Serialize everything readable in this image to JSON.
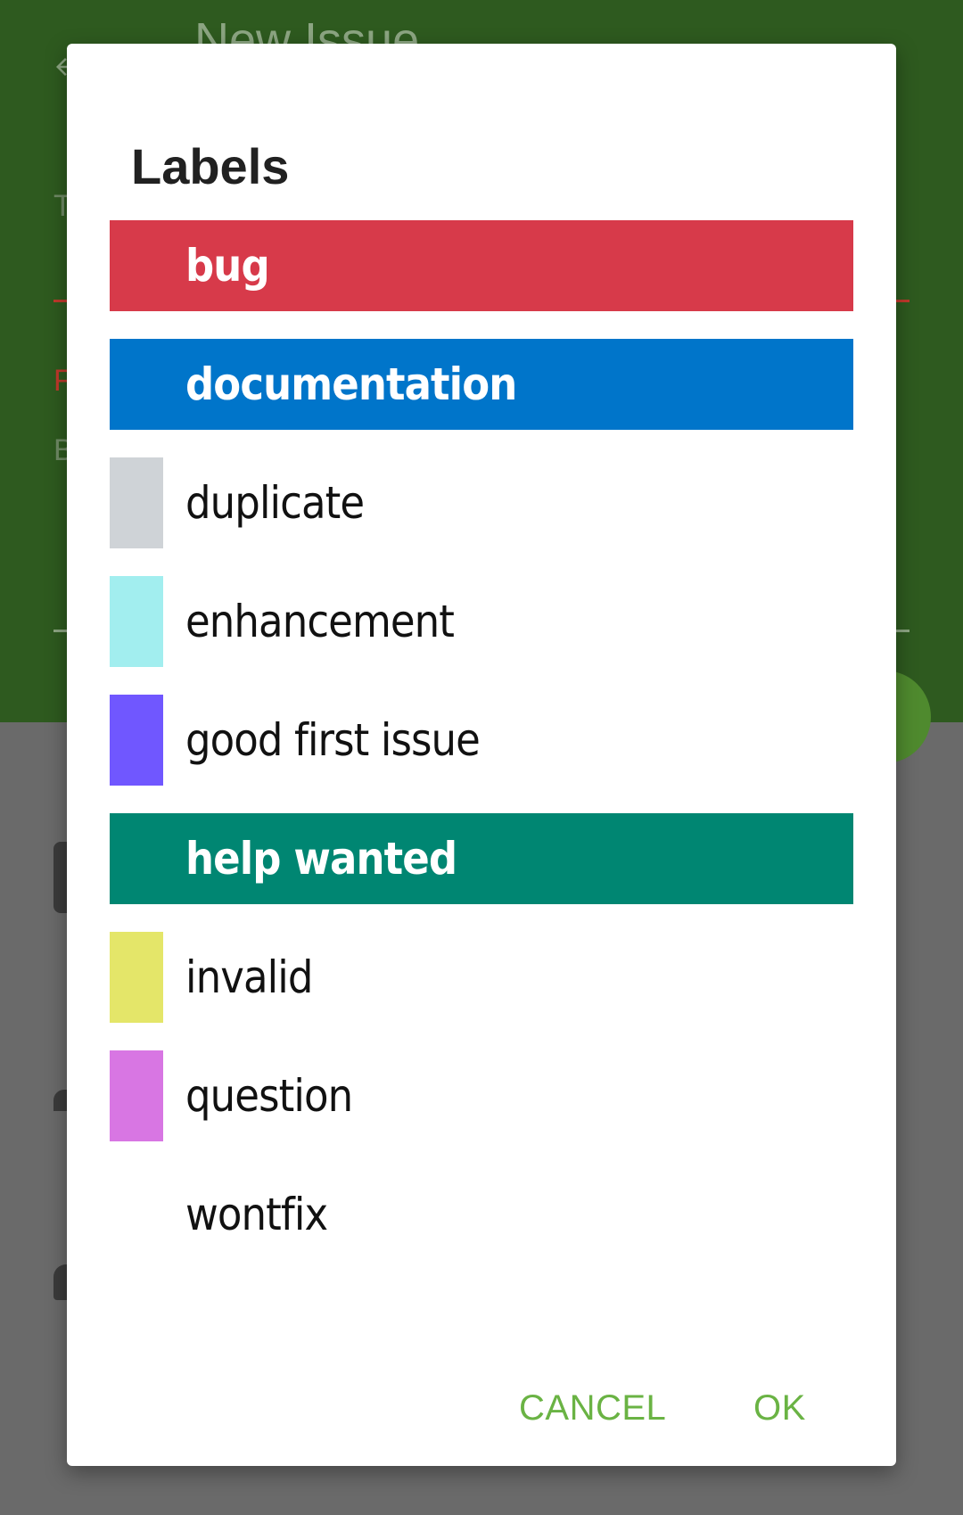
{
  "background": {
    "app_title": "New Issue",
    "field_letters": [
      "T",
      "F",
      "B"
    ]
  },
  "dialog": {
    "title": "Labels",
    "labels": [
      {
        "name": "bug",
        "color": "#d73a4a",
        "selected": true
      },
      {
        "name": "documentation",
        "color": "#0075ca",
        "selected": true
      },
      {
        "name": "duplicate",
        "color": "#cfd3d7",
        "selected": false
      },
      {
        "name": "enhancement",
        "color": "#a2eeef",
        "selected": false
      },
      {
        "name": "good first issue",
        "color": "#7057ff",
        "selected": false
      },
      {
        "name": "help wanted",
        "color": "#008672",
        "selected": true
      },
      {
        "name": "invalid",
        "color": "#e4e669",
        "selected": false
      },
      {
        "name": "question",
        "color": "#d876e3",
        "selected": false
      },
      {
        "name": "wontfix",
        "color": "#ffffff",
        "selected": false
      }
    ],
    "cancel_label": "CANCEL",
    "ok_label": "OK"
  },
  "colors": {
    "accent": "#6ab344",
    "app_bar": "#2e5a1f",
    "scrim": "#6a6a6a"
  }
}
